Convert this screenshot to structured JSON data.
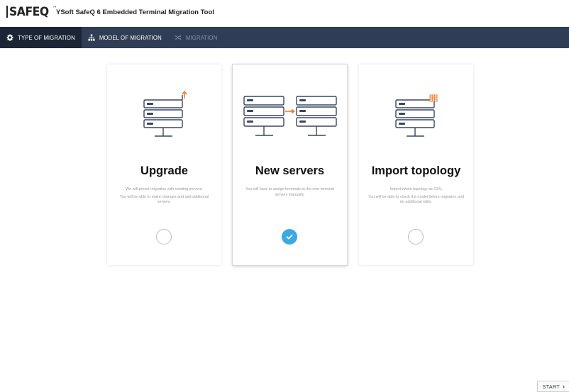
{
  "header": {
    "logo_text": "SAFEQ",
    "logo_tm": "™",
    "app_title": "YSoft SafeQ 6 Embedded Terminal Migration Tool"
  },
  "nav": {
    "items": [
      {
        "label": "TYPE OF MIGRATION",
        "icon": "gear-icon",
        "state": "active"
      },
      {
        "label": "MODEL OF MIGRATION",
        "icon": "hierarchy-icon",
        "state": "normal"
      },
      {
        "label": "MIGRATION",
        "icon": "shuffle-icon",
        "state": "disabled"
      }
    ]
  },
  "cards": [
    {
      "title": "Upgrade",
      "desc1": "We will preset migration with existing servers.",
      "desc2": "You will be able to make changes and add additional servers.",
      "illustration": "server-upgrade-icon",
      "selected": false
    },
    {
      "title": "New servers",
      "desc1": "You will have to assign terminals to the new terminal servers manually.",
      "desc2": "",
      "illustration": "server-migrate-icon",
      "selected": true
    },
    {
      "title": "Import topology",
      "desc1": "Import whole topology as CSV.",
      "desc2": "You will be able to check the model before migration and do additional edits.",
      "illustration": "server-import-icon",
      "selected": false
    }
  ],
  "footer": {
    "start_label": "START"
  },
  "colors": {
    "nav_bg": "#2f3d55",
    "nav_active_bg": "#1c2536",
    "accent_orange": "#f07a22",
    "check_blue": "#3aa9e4",
    "server_stroke": "#3a4560"
  }
}
